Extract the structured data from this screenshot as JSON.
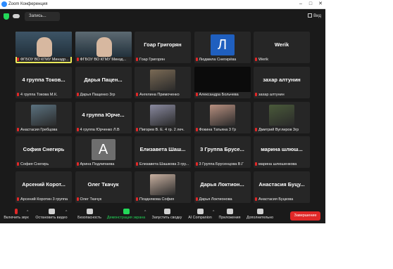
{
  "window": {
    "title": "Zoom Конференция"
  },
  "topbar": {
    "record_label": "Запись...",
    "view_label": "Вид"
  },
  "colors": {
    "mute": "#e02828",
    "active_speaker": "#e8e85a",
    "green": "#23d959",
    "end": "#e02828"
  },
  "tiles": [
    {
      "title": "",
      "name": "ФГБОУ ВО КГМУ Минздр...",
      "kind": "video",
      "bg": "#3d5466",
      "active": true
    },
    {
      "title": "",
      "name": "ФГБОУ ВО КГМУ Минзд...",
      "kind": "video",
      "bg": "#5d6a72"
    },
    {
      "title": "Гоар Григорян",
      "name": "Гоар Григорян",
      "kind": "text"
    },
    {
      "title": "",
      "name": "Людмила Снегирёва",
      "kind": "avatar",
      "letter": "Л",
      "avatar_bg": "#1f5fbf"
    },
    {
      "title": "Werik",
      "name": "Werik",
      "kind": "text"
    },
    {
      "title": "4 группа Токов...",
      "name": "4 группа Токова М.К.",
      "kind": "text"
    },
    {
      "title": "Дарья Пацен...",
      "name": "Дарья Пащенко 3гр",
      "kind": "text"
    },
    {
      "title": "",
      "name": "Ангелина Примоченко",
      "kind": "photo",
      "photo_bg": "#7a6a55"
    },
    {
      "title": "",
      "name": "Александра Больчева",
      "kind": "black"
    },
    {
      "title": "захар алтунин",
      "name": "захар алтунин",
      "kind": "text"
    },
    {
      "title": "",
      "name": "Анастасия Гребцова",
      "kind": "photo",
      "photo_bg": "#5b7280"
    },
    {
      "title": "4 группа Юрче...",
      "name": "4 группа Юрченко Л.В",
      "kind": "text"
    },
    {
      "title": "",
      "name": "Пигорев В. Е. 4 гр. 2 леч.",
      "kind": "photo",
      "photo_bg": "#8a8aa0"
    },
    {
      "title": "",
      "name": "Фокина Татьяна 3 Гр",
      "kind": "photo",
      "photo_bg": "#b89080"
    },
    {
      "title": "",
      "name": "Дмитрий Вуглиров 3гр",
      "kind": "photo",
      "photo_bg": "#4a5a3a"
    },
    {
      "title": "София Снегирь",
      "name": "София Снегирь",
      "kind": "text"
    },
    {
      "title": "",
      "name": "Арина Подлипаева",
      "kind": "avatar",
      "letter": "А",
      "avatar_bg": "#6e6e6e"
    },
    {
      "title": "Елизавета Шаш...",
      "name": "Елизавета Шашкова 3 гру...",
      "kind": "text"
    },
    {
      "title": "3 Группа Брусе...",
      "name": "3 Группа Брусенцова В.Г",
      "kind": "text"
    },
    {
      "title": "марина шлюш...",
      "name": "марина шлюшенкова",
      "kind": "text"
    },
    {
      "title": "Арсений Корот...",
      "name": "Арсений Коротин 3 группа",
      "kind": "text"
    },
    {
      "title": "Олег Ткачук",
      "name": "Олег Ткачук",
      "kind": "text"
    },
    {
      "title": "",
      "name": "Позднякова София",
      "kind": "photo",
      "photo_bg": "#c8b0a0"
    },
    {
      "title": "Дарья Локтион...",
      "name": "Дарья Локтионова",
      "kind": "text"
    },
    {
      "title": "Анастасия Буцу...",
      "name": "Анастасия Буцкова",
      "kind": "text"
    }
  ],
  "toolbar": {
    "mic": "Включить звук",
    "video": "Остановить видео",
    "security": "Безопасность",
    "share": "Демонстрация экрана",
    "summary": "Запустить сводку",
    "ai": "AI Companion",
    "apps": "Приложения",
    "more": "Дополнительно",
    "end": "Завершение"
  }
}
